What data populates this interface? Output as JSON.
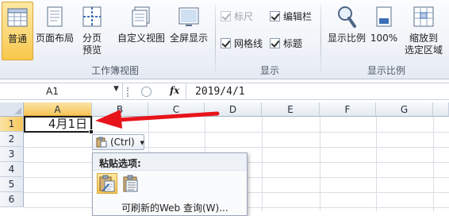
{
  "ribbon": {
    "workbook_views": {
      "normal": "普通",
      "page_layout": "页面布局",
      "page_break_line1": "分页",
      "page_break_line2": "预览",
      "custom_views": "自定义视图",
      "full_screen": "全屏显示",
      "group_label": "工作簿视图"
    },
    "show": {
      "ruler": "标尺",
      "formula_bar": "编辑栏",
      "gridlines": "网格线",
      "headings": "标题",
      "group_label": "显示"
    },
    "zoom": {
      "zoom": "显示比例",
      "hundred": "100%",
      "fit_line1": "缩放到",
      "fit_line2": "选定区域",
      "group_label": "显示比例"
    }
  },
  "formula_bar": {
    "name_box": "A1",
    "fx": "fx",
    "value": "2019/4/1"
  },
  "grid": {
    "columns": [
      "A",
      "B",
      "C",
      "D",
      "E",
      "F",
      "G"
    ],
    "rows": [
      "1",
      "2",
      "3",
      "4",
      "5",
      "6"
    ],
    "cell_a1": "4月1日"
  },
  "paste_tag": {
    "label": "(Ctrl)"
  },
  "paste_menu": {
    "title": "粘贴选项:",
    "web_query": "可刷新的Web 查询(W)..."
  },
  "colors": {
    "annotation_arrow": "#e8141b",
    "active_button": "#fbd774",
    "ribbon_bg": "#eef2f8"
  }
}
